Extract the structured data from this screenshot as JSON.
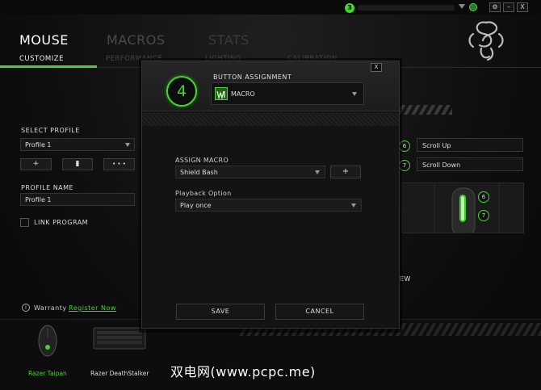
{
  "titlebar": {
    "notification_count": "3",
    "buttons": [
      "⚙",
      "–",
      "X"
    ]
  },
  "nav": {
    "tabs": [
      "MOUSE",
      "MACROS",
      "STATS"
    ]
  },
  "subnav": {
    "items": [
      "CUSTOMIZE",
      "PERFORMANCE",
      "LIGHTING",
      "CALIBRATION"
    ]
  },
  "left_panel": {
    "select_profile_label": "SELECT PROFILE",
    "profile_selected": "Profile 1",
    "add_symbol": "+",
    "delete_symbol": "▮",
    "more_symbol": "• • •",
    "profile_name_label": "PROFILE NAME",
    "profile_name_value": "Profile 1",
    "link_program_label": "LINK PROGRAM",
    "warranty_label": "Warranty",
    "register_link": "Register Now",
    "info_icon": "i"
  },
  "right_panel": {
    "keys": [
      {
        "num": "6",
        "action": "Scroll Up"
      },
      {
        "num": "7",
        "action": "Scroll Down"
      }
    ],
    "preview_keys": [
      "6",
      "7"
    ],
    "view_text": "EW"
  },
  "devices": [
    {
      "name": "Razer Taipan",
      "active": true
    },
    {
      "name": "Razer DeathStalker",
      "active": false
    }
  ],
  "watermark": "双电网(www.pcpc.me)",
  "modal": {
    "close_label": "X",
    "button_number": "4",
    "button_assignment_label": "BUTTON ASSIGNMENT",
    "assignment_value": "MACRO",
    "assign_macro_label": "ASSIGN MACRO",
    "macro_value": "Shield Bash",
    "add_macro_symbol": "+",
    "playback_label": "Playback Option",
    "playback_value": "Play once",
    "save_label": "SAVE",
    "cancel_label": "CANCEL"
  },
  "colors": {
    "accent": "#44d62c",
    "background": "#0e0e0e"
  }
}
